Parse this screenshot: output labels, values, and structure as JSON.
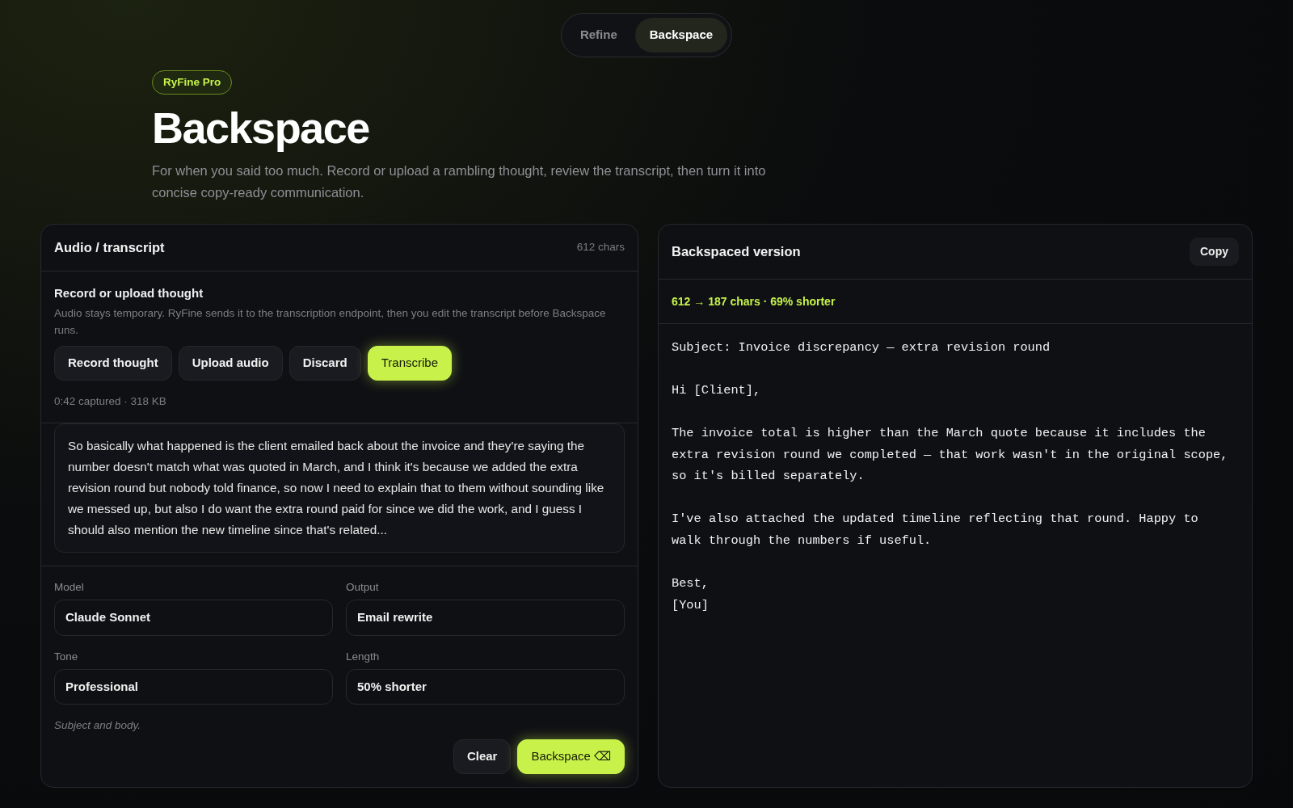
{
  "mode_tabs": [
    {
      "label": "Refine",
      "selected": false
    },
    {
      "label": "Backspace",
      "selected": true
    }
  ],
  "badge": "RyFine Pro",
  "title": "Backspace",
  "description": "For when you said too much. Record or upload a rambling thought, review the transcript, then turn it into concise copy-ready communication.",
  "input_panel": {
    "title": "Audio / transcript",
    "char_count": "612 chars",
    "record_section": {
      "heading": "Record or upload thought",
      "note": "Audio stays temporary. RyFine sends it to the transcription endpoint, then you edit the transcript before Backspace runs.",
      "buttons": [
        {
          "label": "Record thought",
          "primary": false
        },
        {
          "label": "Upload audio",
          "primary": false
        },
        {
          "label": "Discard",
          "primary": false
        },
        {
          "label": "Transcribe",
          "primary": true
        }
      ],
      "status": "0:42 captured · 318 KB"
    },
    "transcript": "So basically what happened is the client emailed back about the invoice and they're saying the number doesn't match what was quoted in March, and I think it's because we added the extra revision round but nobody told finance, so now I need to explain that to them without sounding like we messed up, but also I do want the extra round paid for since we did the work, and I guess I should also mention the new timeline since that's related...",
    "settings": [
      {
        "label": "Model",
        "value": "Claude Sonnet"
      },
      {
        "label": "Output",
        "value": "Email rewrite"
      },
      {
        "label": "Tone",
        "value": "Professional"
      },
      {
        "label": "Length",
        "value": "50% shorter"
      }
    ],
    "hint": "Subject and body.",
    "actions": [
      {
        "label": "Clear",
        "primary": false
      },
      {
        "label": "Backspace ⌫",
        "primary": true
      }
    ]
  },
  "output_panel": {
    "title": "Backspaced version",
    "copy_button": "Copy",
    "stats": "612 → 187 chars · 69% shorter",
    "paragraphs": [
      [
        "Subject: Invoice discrepancy — extra revision round"
      ],
      [
        "Hi [Client],"
      ],
      [
        "The invoice total is higher than the March quote because it includes the",
        "extra revision round we completed — that work wasn't in the original scope,",
        "so it's billed separately."
      ],
      [
        "I've also attached the updated timeline reflecting that round. Happy to",
        "walk through the numbers if useful."
      ],
      [
        "Best,",
        "[You]"
      ]
    ]
  }
}
